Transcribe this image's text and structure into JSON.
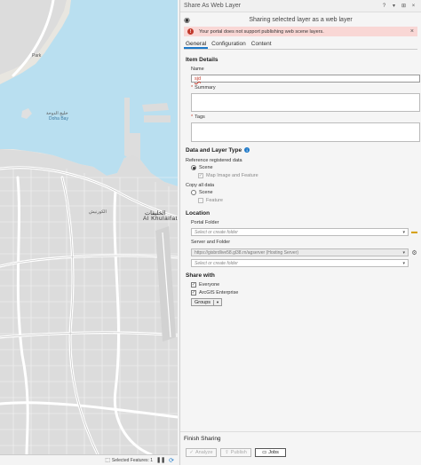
{
  "map": {
    "labels": {
      "doha_bay": "خليج الدوحة",
      "doha_bay_en": "Doha Bay",
      "al_khulaifat": "Al Khulaifat",
      "al_khulaifat_ar": "الخليفات",
      "park": "Park",
      "corniche_ar": "الكورنيش"
    },
    "status": {
      "selected_features": "Selected Features: 1"
    },
    "colors": {
      "water": "#b7dff2",
      "land": "#ececec",
      "urban": "#d9d9d9",
      "road": "#ffffff"
    }
  },
  "pane": {
    "title": "Share As Web Layer",
    "controls": {
      "help": "?",
      "pin": "▾",
      "autohide": "⊞",
      "close": "×"
    },
    "header": "Sharing selected layer as a web layer",
    "error": {
      "message": "Your portal does not support publishing web scene layers."
    },
    "tabs": [
      {
        "label": "General"
      },
      {
        "label": "Configuration"
      },
      {
        "label": "Content"
      }
    ],
    "item_details": {
      "title": "Item Details",
      "name_label": "Name",
      "name_value": "sjd",
      "summary_label": "Summary",
      "tags_label": "Tags"
    },
    "data_layer": {
      "title": "Data and Layer Type",
      "reference_label": "Reference registered data",
      "scene": "Scene",
      "map_image_feature": "Map Image and Feature",
      "copy_label": "Copy all data",
      "copy_scene": "Scene",
      "copy_feature": "Feature"
    },
    "location": {
      "title": "Location",
      "portal_folder_label": "Portal Folder",
      "portal_folder_placeholder": "Select or create folder",
      "server_folder_label": "Server and Folder",
      "server_value": "https://gisbrdlive58.gl38.rn/agserver (Hosting Server)",
      "server_folder_placeholder": "Select or create folder"
    },
    "share_with": {
      "title": "Share with",
      "everyone": "Everyone",
      "arcgis_enterprise": "ArcGIS Enterprise",
      "groups": "Groups"
    },
    "finish": {
      "title": "Finish Sharing",
      "analyze": "Analyze",
      "publish": "Publish",
      "jobs": "Jobs"
    }
  }
}
